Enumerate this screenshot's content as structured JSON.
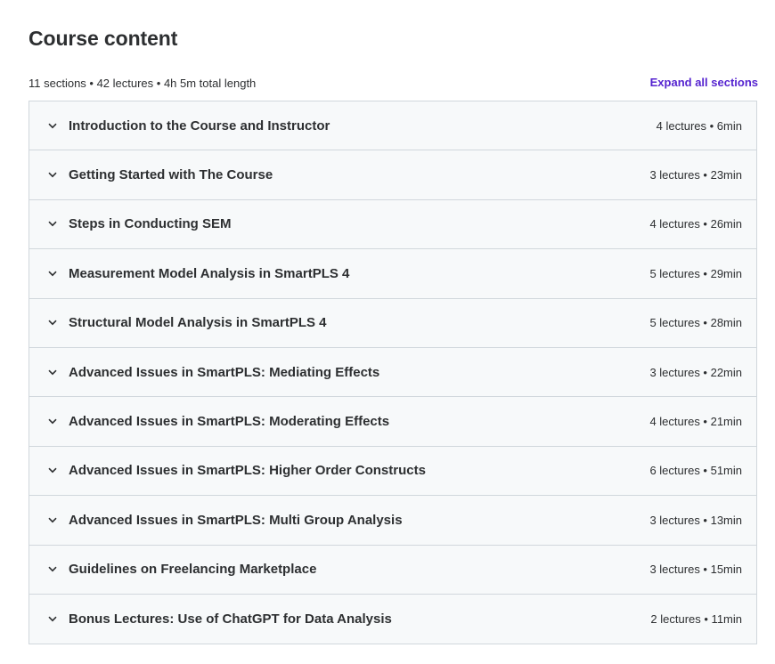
{
  "header": {
    "title": "Course content",
    "summary": "11 sections • 42 lectures • 4h 5m total length",
    "expand_label": "Expand all sections",
    "accent_color": "#5624d0"
  },
  "sections": [
    {
      "title": "Introduction to the Course and Instructor",
      "meta": "4 lectures • 6min"
    },
    {
      "title": "Getting Started with The Course",
      "meta": "3 lectures • 23min"
    },
    {
      "title": "Steps in Conducting SEM",
      "meta": "4 lectures • 26min"
    },
    {
      "title": "Measurement Model Analysis in SmartPLS 4",
      "meta": "5 lectures • 29min"
    },
    {
      "title": "Structural Model Analysis in SmartPLS 4",
      "meta": "5 lectures • 28min"
    },
    {
      "title": "Advanced Issues in SmartPLS: Mediating Effects",
      "meta": "3 lectures • 22min"
    },
    {
      "title": "Advanced Issues in SmartPLS: Moderating Effects",
      "meta": "4 lectures • 21min"
    },
    {
      "title": "Advanced Issues in SmartPLS: Higher Order Constructs",
      "meta": "6 lectures • 51min"
    },
    {
      "title": "Advanced Issues in SmartPLS: Multi Group Analysis",
      "meta": "3 lectures • 13min"
    },
    {
      "title": "Guidelines on Freelancing Marketplace",
      "meta": "3 lectures • 15min"
    },
    {
      "title": "Bonus Lectures: Use of ChatGPT for Data Analysis",
      "meta": "2 lectures • 11min"
    }
  ],
  "icons": {
    "section_toggle": "chevron-down-icon"
  }
}
